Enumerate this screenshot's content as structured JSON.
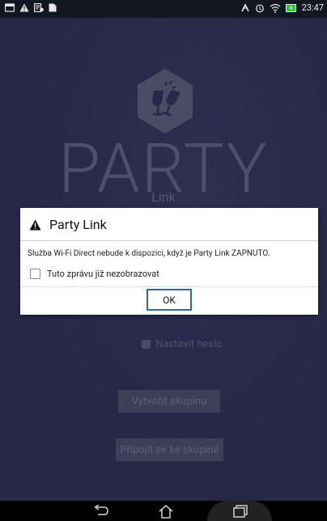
{
  "status_bar": {
    "time": "23:47",
    "icons_left": [
      "notification-icon",
      "warning-icon",
      "sync-icon",
      "document-icon"
    ],
    "icons_right": [
      "party-link-icon",
      "alarm-icon",
      "wifi-icon",
      "battery-charging-icon"
    ]
  },
  "app": {
    "title_big": "PARTY",
    "subtitle": "Link",
    "password_checkbox_label": "Nastavit heslo",
    "create_group_button": "Vytvořit skupinu",
    "join_group_button": "Připojit se ke skupině"
  },
  "dialog": {
    "title": "Party Link",
    "message": "Služba Wi-Fi Direct nebude k dispozici, když je Party Link ZAPNUTO.",
    "checkbox_label": "Tuto zprávu již nezobrazovat",
    "ok_button": "OK"
  },
  "colors": {
    "app_background": "#272848",
    "dialog_background": "#ffffff",
    "ok_border": "#2a6aa8"
  }
}
